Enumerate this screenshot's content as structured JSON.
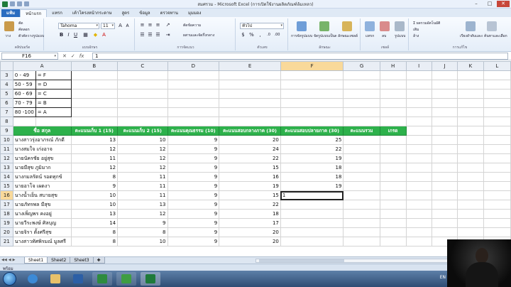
{
  "window": {
    "title": "สมศรวม - Microsoft Excel (การเปิดใช้งานผลิตภัณฑ์ล้มเหลว)",
    "controls": [
      "–",
      "□",
      "✕"
    ]
  },
  "ribbon": {
    "tabs": [
      "แฟ้ม",
      "หน้าแรก",
      "แทรก",
      "เค้าโครงหน้ากระดาษ",
      "สูตร",
      "ข้อมูล",
      "ตรวจทาน",
      "มุมมอง"
    ],
    "active_tab_index": 1,
    "clipboard": {
      "paste": "วาง",
      "cut": "ตัด",
      "copy": "คัดลอก",
      "format_painter": "ตัวคัดวางรูปแบบ",
      "label": "คลิปบอร์ด"
    },
    "font": {
      "name": "Tahoma",
      "size": "11",
      "label": "แบบอักษร"
    },
    "alignment": {
      "wrap": "ตัดข้อความ",
      "merge": "ผสานและจัดกึ่งกลาง",
      "label": "การจัดแนว"
    },
    "number": {
      "format": "ทั่วไป",
      "label": "ตัวเลข"
    },
    "styles": {
      "conditional": "การจัดรูปแบบตามเงื่อนไข",
      "table": "จัดรูปแบบเป็นตาราง",
      "cell": "ลักษณะเซลล์",
      "label": "ลักษณะ"
    },
    "cells": {
      "insert": "แทรก",
      "delete": "ลบ",
      "format": "รูปแบบ",
      "label": "เซลล์"
    },
    "editing": {
      "autosum": "ผลรวมอัตโนมัติ",
      "fill": "เติม",
      "clear": "ล้าง",
      "sort": "เรียงลำดับและกรอง",
      "find": "ค้นหาและเลือก",
      "label": "การแก้ไข"
    }
  },
  "formula_bar": {
    "name_box": "F16",
    "fx_label": "fx",
    "content": "1"
  },
  "columns": [
    "",
    "A",
    "B",
    "C",
    "D",
    "E",
    "F",
    "G",
    "H",
    "I",
    "J",
    "K",
    "L"
  ],
  "selected_column": "F",
  "rows": [
    {
      "n": "3",
      "a": "0 - 49",
      "a2": "= F"
    },
    {
      "n": "4",
      "a": "50 - 59",
      "a2": "= D"
    },
    {
      "n": "5",
      "a": "60 - 69",
      "a2": "= C"
    },
    {
      "n": "6",
      "a": "70 - 79",
      "a2": "= B"
    },
    {
      "n": "7",
      "a": "80 -100",
      "a2": "= A"
    },
    {
      "n": "8",
      "a": "",
      "a2": ""
    }
  ],
  "header_row": {
    "n": "9",
    "name": "ชื่อ  สกุล",
    "b": "คะแนนเก็บ 1 (15)",
    "c": "คะแนนเก็บ 2 (15)",
    "d": "คะแนนคุณธรรม (10)",
    "e": "คะแนนสอบกลางภาค (30)",
    "f": "คะแนนสอบปลายภาค (30)",
    "g": "คะแนนรวม",
    "h": "เกรด"
  },
  "students": [
    {
      "n": "10",
      "name": "นางสาวรุ่งอาภรณ์ ภักดี",
      "b": "13",
      "c": "10",
      "d": "9",
      "e": "20",
      "f": "25"
    },
    {
      "n": "11",
      "name": "นางสมใจ เก่งอาจ",
      "b": "12",
      "c": "12",
      "d": "9",
      "e": "24",
      "f": "22"
    },
    {
      "n": "12",
      "name": "นายนัครชัย อยู่สุข",
      "b": "11",
      "c": "12",
      "d": "9",
      "e": "22",
      "f": "19"
    },
    {
      "n": "13",
      "name": "นายมีสุข ภูมิมาก",
      "b": "12",
      "c": "12",
      "d": "9",
      "e": "15",
      "f": "18"
    },
    {
      "n": "14",
      "name": "นางกมลรัตน์ รอดทุกข์",
      "b": "8",
      "c": "11",
      "d": "9",
      "e": "16",
      "f": "18"
    },
    {
      "n": "15",
      "name": "นายอาโจ เผดงา",
      "b": "9",
      "c": "11",
      "d": "9",
      "e": "19",
      "f": "19"
    },
    {
      "n": "16",
      "name": "นางน้ำเย็น สบายสุข",
      "b": "10",
      "c": "11",
      "d": "9",
      "e": "15",
      "f": "1"
    },
    {
      "n": "17",
      "name": "นายภัทรพล มีสุข",
      "b": "10",
      "c": "13",
      "d": "9",
      "e": "22",
      "f": ""
    },
    {
      "n": "18",
      "name": "นางเพ็ญพร คงอยู่",
      "b": "13",
      "c": "12",
      "d": "9",
      "e": "18",
      "f": ""
    },
    {
      "n": "19",
      "name": "นายวีระพงษ์ ศิลบุญ",
      "b": "14",
      "c": "9",
      "d": "9",
      "e": "17",
      "f": ""
    },
    {
      "n": "20",
      "name": "นายจิรา  ตั้งศรีสุข",
      "b": "8",
      "c": "8",
      "d": "9",
      "e": "20",
      "f": ""
    },
    {
      "n": "21",
      "name": "นางสาวทัศพิรมณ์ มูลศรี",
      "b": "8",
      "c": "10",
      "d": "9",
      "e": "20",
      "f": ""
    }
  ],
  "sheet_tabs": [
    "Sheet1",
    "Sheet2",
    "Sheet3"
  ],
  "active_sheet_index": 0,
  "status": {
    "ready": "พร้อม"
  },
  "taskbar": {
    "tray_text": "EN"
  },
  "colors": {
    "header_fill": "#2db14b",
    "selection": "#f9d99a",
    "file_tab": "#2a6cc0"
  }
}
